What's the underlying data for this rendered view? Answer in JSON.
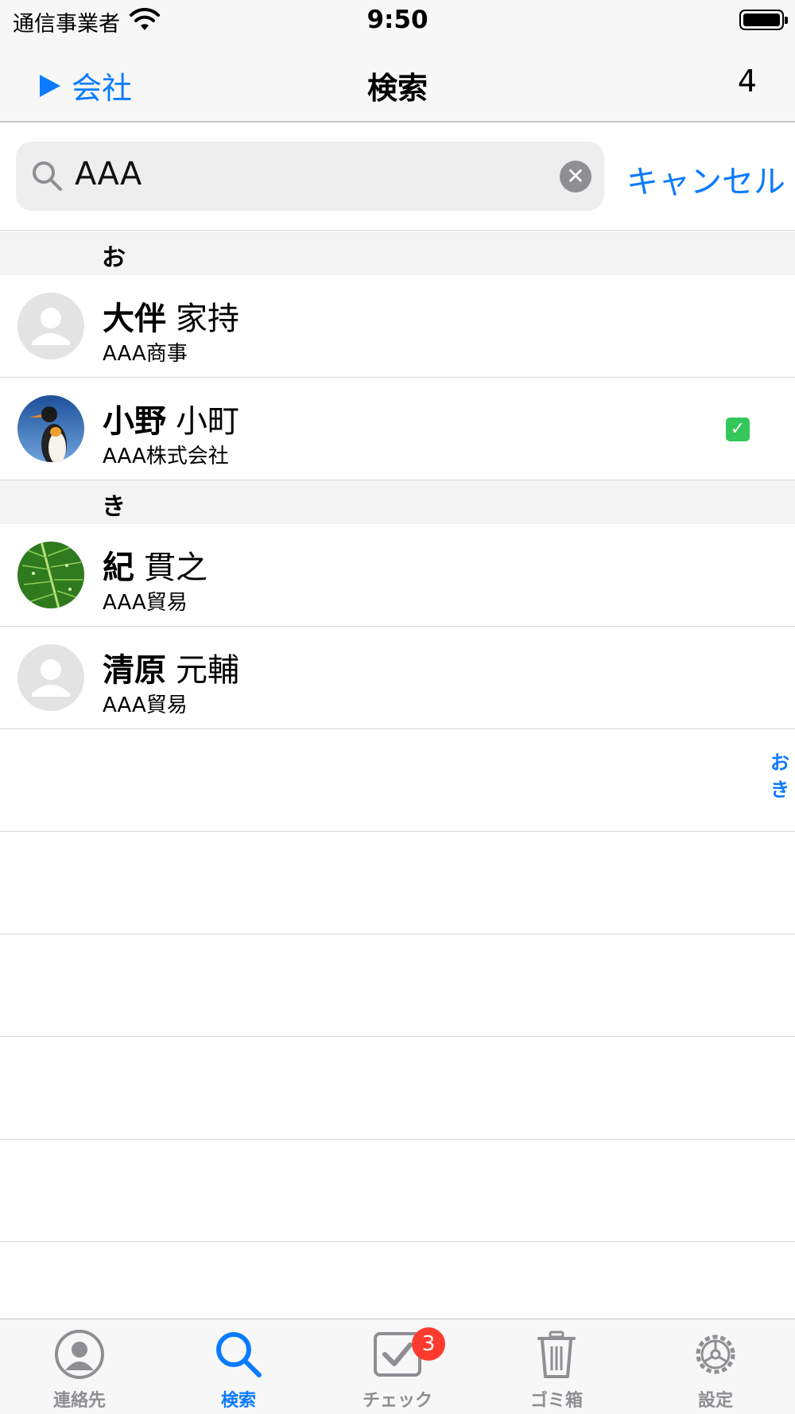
{
  "status": {
    "carrier": "通信事業者",
    "time": "9:50"
  },
  "nav": {
    "back_label": "会社",
    "title": "検索",
    "count": "4"
  },
  "search": {
    "query": "AAA",
    "cancel_label": "キャンセル"
  },
  "sections": [
    {
      "header": "お",
      "rows": [
        {
          "last": "大伴",
          "first": "家持",
          "company": "AAA商事",
          "avatar": "placeholder",
          "checked": false
        },
        {
          "last": "小野",
          "first": "小町",
          "company": "AAA株式会社",
          "avatar": "penguin-photo",
          "checked": true
        }
      ]
    },
    {
      "header": "き",
      "rows": [
        {
          "last": "紀",
          "first": "貫之",
          "company": "AAA貿易",
          "avatar": "leaf-photo",
          "checked": false
        },
        {
          "last": "清原",
          "first": "元輔",
          "company": "AAA貿易",
          "avatar": "placeholder",
          "checked": false
        }
      ]
    }
  ],
  "index": [
    "お",
    "き"
  ],
  "tabs": [
    {
      "label": "連絡先",
      "icon": "person-circle-icon",
      "active": false
    },
    {
      "label": "検索",
      "icon": "search-icon",
      "active": true
    },
    {
      "label": "チェック",
      "icon": "checkbox-icon",
      "active": false,
      "badge": "3"
    },
    {
      "label": "ゴミ箱",
      "icon": "trash-icon",
      "active": false
    },
    {
      "label": "設定",
      "icon": "gear-icon",
      "active": false
    }
  ],
  "colors": {
    "accent": "#0a7bff",
    "badge": "#ff3b30",
    "check": "#34c759",
    "tab_inactive": "#8e8e93"
  }
}
